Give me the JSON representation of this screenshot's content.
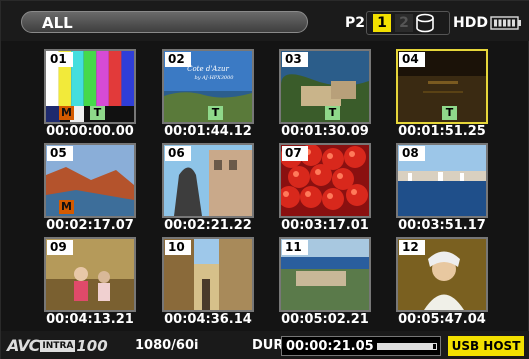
{
  "header": {
    "title": "ALL",
    "p2_label": "P2",
    "slot1": "1",
    "slot2": "2",
    "hdd_label": "HDD",
    "icons": [
      "hdd-disk-icon",
      "battery-icon"
    ]
  },
  "clips": [
    {
      "number": "01",
      "timecode": "00:00:00.00",
      "m": "M",
      "t": "T",
      "scene": "color-bars"
    },
    {
      "number": "02",
      "timecode": "00:01:44.12",
      "m": "",
      "t": "T",
      "scene": "coast-title",
      "caption": "Cote d'Azur\nby AJ-HPX3000"
    },
    {
      "number": "03",
      "timecode": "00:01:30.09",
      "m": "",
      "t": "T",
      "scene": "aerial-town"
    },
    {
      "number": "04",
      "timecode": "00:01:51.25",
      "m": "",
      "t": "T",
      "scene": "dark-sea",
      "selected": true
    },
    {
      "number": "05",
      "timecode": "00:02:17.07",
      "m": "M",
      "t": "",
      "scene": "red-rocks"
    },
    {
      "number": "06",
      "timecode": "00:02:21.22",
      "m": "",
      "t": "",
      "scene": "statue"
    },
    {
      "number": "07",
      "timecode": "00:03:17.01",
      "m": "",
      "t": "",
      "scene": "tomatoes"
    },
    {
      "number": "08",
      "timecode": "00:03:51.17",
      "m": "",
      "t": "",
      "scene": "harbor"
    },
    {
      "number": "09",
      "timecode": "00:04:13.21",
      "m": "",
      "t": "",
      "scene": "cafe"
    },
    {
      "number": "10",
      "timecode": "00:04:36.14",
      "m": "",
      "t": "",
      "scene": "alley"
    },
    {
      "number": "11",
      "timecode": "00:05:02.21",
      "m": "",
      "t": "",
      "scene": "aerial-coast"
    },
    {
      "number": "12",
      "timecode": "00:05:47.04",
      "m": "",
      "t": "",
      "scene": "portrait"
    }
  ],
  "footer": {
    "codec_a": "AVC",
    "codec_intra": "INTRA",
    "codec_rate": "100",
    "format": "1080/60i",
    "dur_label": "DUR",
    "dur_value": "00:00:21.05",
    "dur_progress": 0.95,
    "usb_label": "USB HOST"
  }
}
